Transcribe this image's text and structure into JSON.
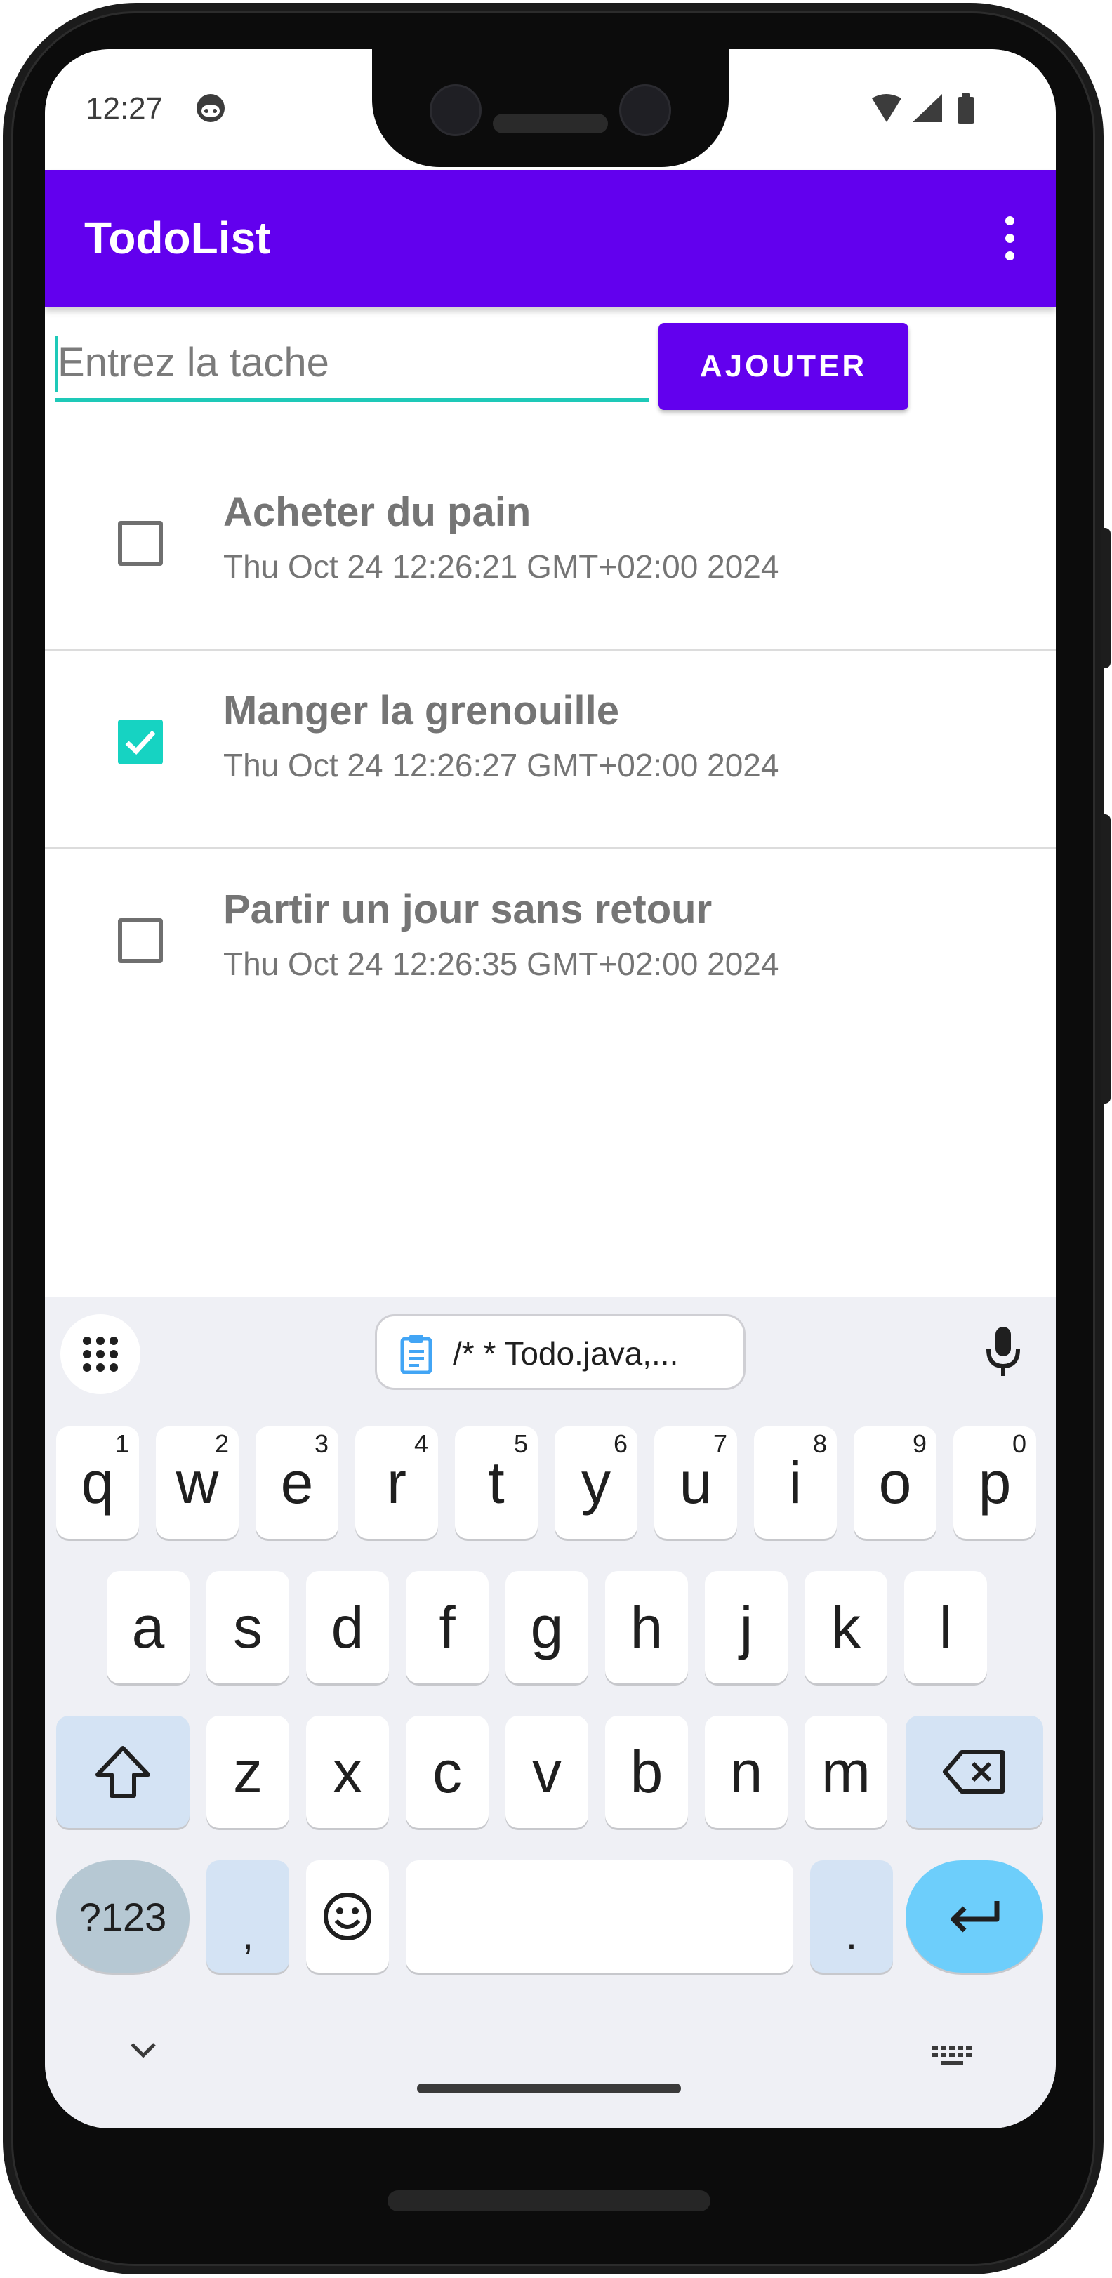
{
  "status_bar": {
    "time": "12:27"
  },
  "app_bar": {
    "title": "TodoList"
  },
  "input_row": {
    "placeholder": "Entrez la tache",
    "add_label": "AJOUTER"
  },
  "tasks": [
    {
      "title": "Acheter du pain",
      "date": "Thu Oct 24 12:26:21 GMT+02:00 2024",
      "checked": false
    },
    {
      "title": "Manger la grenouille",
      "date": "Thu Oct 24 12:26:27 GMT+02:00 2024",
      "checked": true
    },
    {
      "title": "Partir un jour sans retour",
      "date": "Thu Oct 24 12:26:35 GMT+02:00 2024",
      "checked": false
    }
  ],
  "keyboard": {
    "clipboard_text": "/*  * Todo.java,...",
    "row1": [
      {
        "key": "q",
        "hint": "1"
      },
      {
        "key": "w",
        "hint": "2"
      },
      {
        "key": "e",
        "hint": "3"
      },
      {
        "key": "r",
        "hint": "4"
      },
      {
        "key": "t",
        "hint": "5"
      },
      {
        "key": "y",
        "hint": "6"
      },
      {
        "key": "u",
        "hint": "7"
      },
      {
        "key": "i",
        "hint": "8"
      },
      {
        "key": "o",
        "hint": "9"
      },
      {
        "key": "p",
        "hint": "0"
      }
    ],
    "row2": [
      "a",
      "s",
      "d",
      "f",
      "g",
      "h",
      "j",
      "k",
      "l"
    ],
    "row3": [
      "z",
      "x",
      "c",
      "v",
      "b",
      "n",
      "m"
    ],
    "symbols_label": "?123",
    "comma_label": ",",
    "period_label": "."
  },
  "colors": {
    "primary": "#6200ee",
    "accent": "#1ec9b8",
    "checkbox_checked": "#16d3c2",
    "enter_key": "#6dcefb"
  }
}
